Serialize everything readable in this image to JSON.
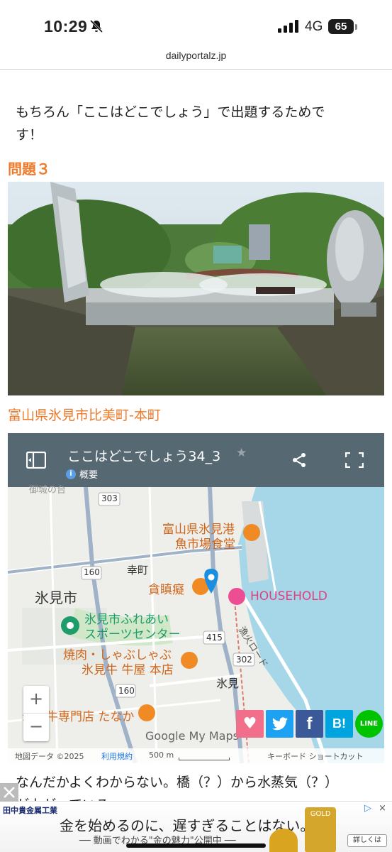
{
  "status": {
    "time": "10:29",
    "network": "4G",
    "battery": "65"
  },
  "url": "dailyportalz.jp",
  "article": {
    "para1_line1": "もちろん「ここはどこでしょう」で出題するためで",
    "para1_line2": "す！",
    "question_heading": "問題３",
    "caption": "富山県氷見市比美町-本町",
    "bottom_line1": "なんだかよくわからない。橋（？）から水蒸気（？）",
    "bottom_line2": "が上がっている。"
  },
  "map": {
    "title": "ここはどこでしょう34_3",
    "overview": "概要",
    "labels": {
      "poi1_l1": "富山県氷見港",
      "poi1_l2": "魚市場食堂",
      "saiwai": "幸町",
      "poi2": "貪瞋癡",
      "household": "HOUSEHOLD",
      "himi_city": "氷見市",
      "poi3_l1": "氷見市ふれあい",
      "poi3_l2": "スポーツセンター",
      "poi4_l1": "焼肉・しゃぶしゃぶ",
      "poi4_l2": "氷見牛 牛屋 本店",
      "road_name": "漁火ロード",
      "himi_station": "氷見",
      "poi5": "氷見牛専門店 たなか",
      "route_303": "303",
      "route_160a": "160",
      "route_160b": "160",
      "route_415": "415",
      "route_302": "302",
      "top_cut": "御城の台",
      "google": "Google My Maps"
    },
    "attribution": {
      "data": "地図データ ©2025",
      "terms": "利用規約",
      "scale": "500 m",
      "keyboard": "キーボード ショートカット"
    },
    "zoom_in": "+",
    "zoom_out": "−"
  },
  "share": {
    "twitter": "t",
    "facebook": "f",
    "hatena": "B!",
    "line": "LINE"
  },
  "ad": {
    "brand": "田中貴金属工業",
    "headline": "金を始めるのに、遅すぎることはない。",
    "sub": "── 動画でわかる\"金の魅力\"公開中 ──",
    "cta": "詳しくは",
    "gold_label": "GOLD"
  },
  "colors": {
    "accent": "#ee7a2a",
    "map_header": "#566872",
    "water": "#a6d7e8",
    "marker": "#1a8fe0"
  }
}
